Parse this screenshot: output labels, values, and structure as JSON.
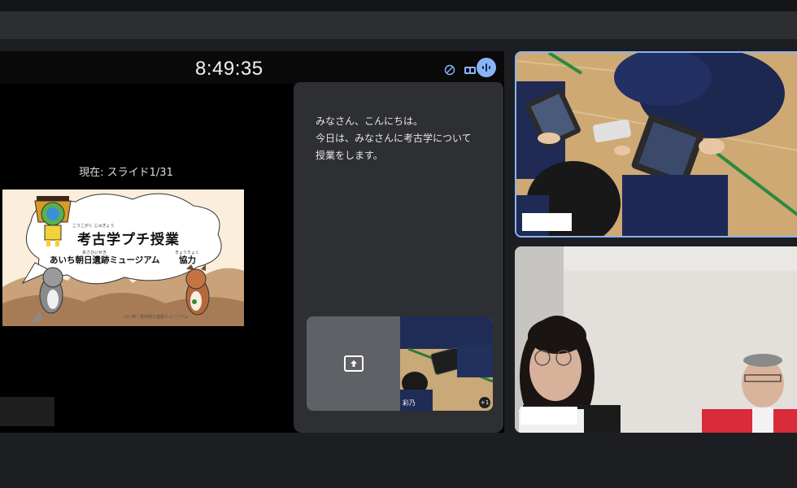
{
  "presenter": {
    "clock": "8:49:35",
    "slide_status": "現在: スライド1/31",
    "icons": [
      "edit-off-icon",
      "presentation-grid-icon",
      "mic-active-icon"
    ]
  },
  "slide": {
    "title": "考古学プチ授業",
    "title_ruby": "こうこがく じゅぎょう",
    "subtitle": "あいち朝日遺跡ミュージアム",
    "subtitle_ruby": "あさひいせき",
    "cooperation": "協力",
    "cooperation_ruby": "きょうりょく",
    "credit": "(C) 西・愛知朝日遺跡ミュージアム"
  },
  "notes": {
    "lines": [
      "みなさん、こんにちは。",
      "今日は、みなさんに考古学について",
      "授業をします。"
    ]
  },
  "thumbnail": {
    "name": "彩乃",
    "count": "+1"
  },
  "colors": {
    "accent": "#8ab4f8",
    "background": "#1d1e21",
    "notes_panel": "#2e2f33"
  }
}
